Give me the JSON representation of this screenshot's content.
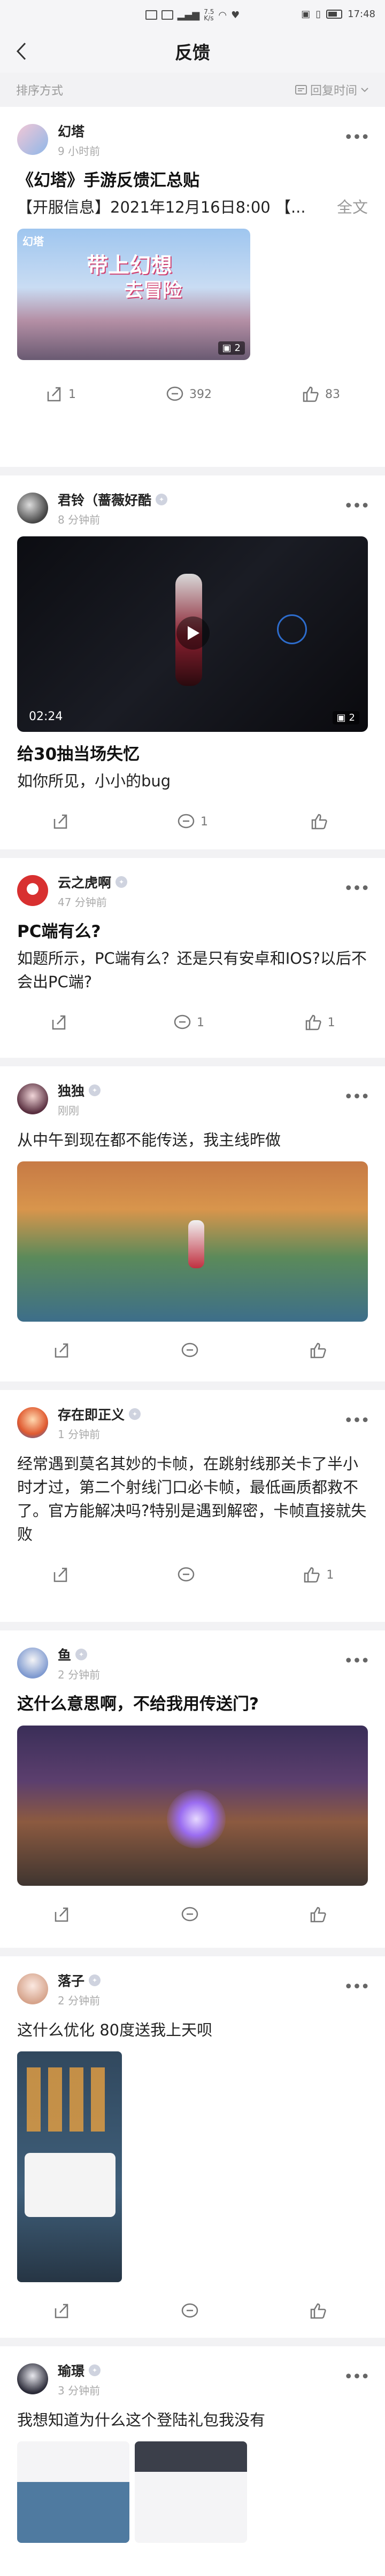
{
  "status": {
    "speed": "7.5\nK/s",
    "time": "17:48"
  },
  "header": {
    "title": "反馈",
    "sort_label": "排序方式",
    "sort_value": "回复时间"
  },
  "posts": [
    {
      "author": "幻塔",
      "time": "9 小时前",
      "title": "《幻塔》手游反馈汇总贴",
      "body": "【开服信息】2021年12月16日8:00 【...",
      "more": "全文",
      "media": {
        "caption_a": "幻塔",
        "caption_b": "带上幻想",
        "caption_c": "去冒险",
        "count": "2"
      },
      "shares": "1",
      "comments": "392",
      "likes": "83"
    },
    {
      "author": "君铃（蔷薇好酷",
      "time": "8 分钟前",
      "title": "给30抽当场失忆",
      "body": "如你所见，小小的bug",
      "media": {
        "duration": "02:24",
        "count": "2"
      },
      "shares": "",
      "comments": "1",
      "likes": ""
    },
    {
      "author": "云之虎啊",
      "time": "47 分钟前",
      "title": "PC端有么?",
      "body": "如题所示，PC端有么？还是只有安卓和IOS?以后不会出PC端?",
      "shares": "",
      "comments": "1",
      "likes": "1"
    },
    {
      "author": "独独",
      "time": "刚刚",
      "title": "",
      "body": "从中午到现在都不能传送，我主线昨做",
      "shares": "",
      "comments": "",
      "likes": ""
    },
    {
      "author": "存在即正义",
      "time": "1 分钟前",
      "title": "",
      "body": "经常遇到莫名其妙的卡帧，在跳射线那关卡了半小时才过，第二个射线门口必卡帧，最低画质都救不了。官方能解决吗?特别是遇到解密，卡帧直接就失败",
      "shares": "",
      "comments": "",
      "likes": "1"
    },
    {
      "author": "鱼",
      "time": "2 分钟前",
      "title": "这什么意思啊，不给我用传送门?",
      "body": "",
      "shares": "",
      "comments": "",
      "likes": ""
    },
    {
      "author": "落子",
      "time": "2 分钟前",
      "title": "",
      "body": "这什么优化 80度送我上天呗",
      "shares": "",
      "comments": "",
      "likes": ""
    },
    {
      "author": "瑜璟",
      "time": "3 分钟前",
      "title": "",
      "body": "我想知道为什么这个登陆礼包我没有",
      "shares": "",
      "comments": "",
      "likes": ""
    }
  ]
}
